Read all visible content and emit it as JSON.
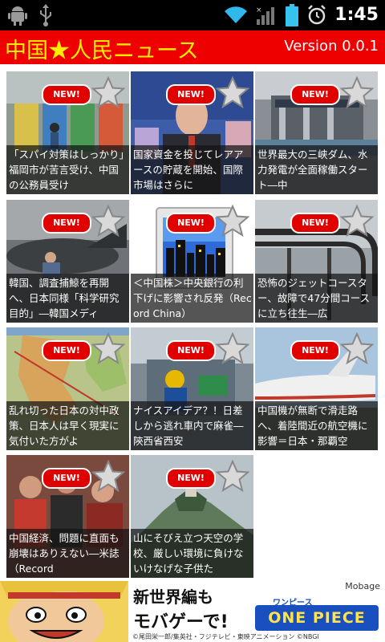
{
  "status_bar": {
    "time": "1:45",
    "left_icons": [
      "android-debug-icon",
      "usb-icon"
    ],
    "right_icons": [
      "wifi-icon",
      "signal-icon",
      "battery-icon",
      "alarm-icon"
    ]
  },
  "app": {
    "title": "中国★人民ニュース",
    "version": "Version 0.0.1",
    "colors": {
      "titlebar": "#ee0000",
      "title_text": "#ffee00"
    }
  },
  "news": {
    "badge_label": "NEW!",
    "items": [
      {
        "caption": "「スパイ対策はしっかり」福岡市が苦言受け、中国の公務員受け"
      },
      {
        "caption": "国家資金を投じてレアアースの貯蔵を開始、国際市場はさらに"
      },
      {
        "caption": "世界最大の三峡ダム、水力発電が全面稼働スタート―中"
      },
      {
        "caption": "韓国、調査捕鯨を再開へ、日本同様「科学研究目的」―韓国メディ"
      },
      {
        "caption": "＜中国株＞中央銀行の利下げに影響され反発（Record China）"
      },
      {
        "caption": "恐怖のジェットコースター、故障で47分間コースに立ち往生―広"
      },
      {
        "caption": "乱れ切った日本の対中政策、日本人は早く現実に気付いた方がよ"
      },
      {
        "caption": "ナイスアイデア？！日差しから逃れ車内で麻雀―陝西省西安"
      },
      {
        "caption": "中国機が無断で滑走路へ、着陸間近の航空機に影響＝日本・那覇空"
      },
      {
        "caption": "中国経済、問題に直面も崩壊はありえない―米誌（Record"
      },
      {
        "caption": "山にそびえ立つ天空の学校、厳しい環境に負けないけなげな子供た"
      }
    ]
  },
  "banner": {
    "brand": "Mobage",
    "line1": "新世界編も",
    "line2": "モバゲーで!",
    "product_sub": "ワンピース",
    "product": "ONE PIECE",
    "credit": "©尾田栄一郎/集英社・フジテレビ・東映アニメーション ©NBGI"
  }
}
